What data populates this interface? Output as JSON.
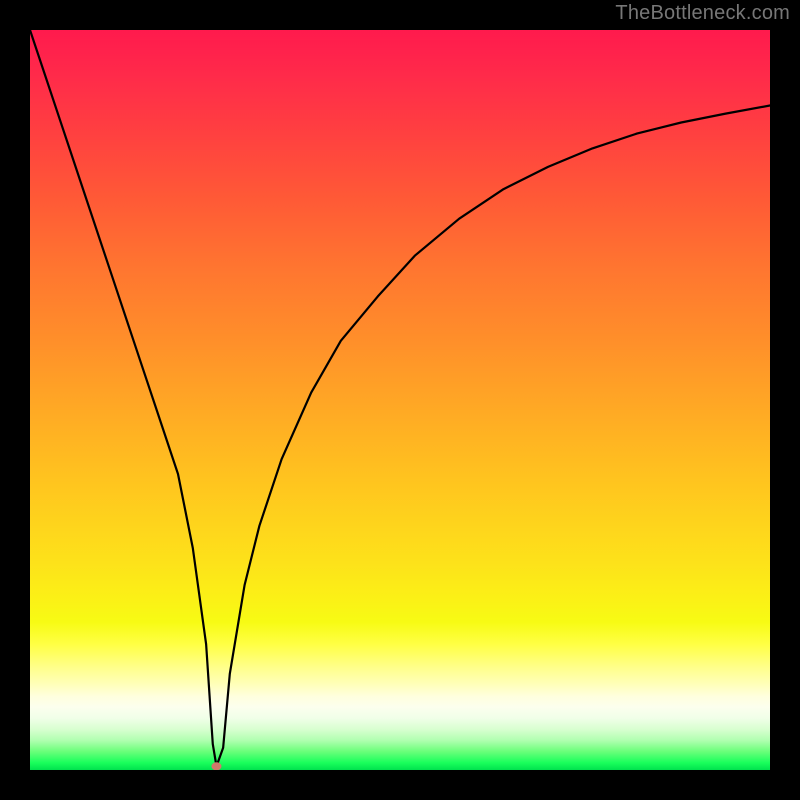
{
  "watermark": "TheBottleneck.com",
  "chart_data": {
    "type": "line",
    "title": "",
    "xlabel": "",
    "ylabel": "",
    "xlim": [
      0,
      100
    ],
    "ylim": [
      0,
      100
    ],
    "grid": false,
    "legend": false,
    "series": [
      {
        "name": "bottleneck-curve",
        "x": [
          0,
          2,
          5,
          8,
          11,
          14,
          17,
          20,
          22,
          23.8,
          24.7,
          25.2,
          26.1,
          27,
          29,
          31,
          34,
          38,
          42,
          47,
          52,
          58,
          64,
          70,
          76,
          82,
          88,
          94,
          100
        ],
        "y": [
          100,
          94,
          85,
          76,
          67,
          58,
          49,
          40,
          30,
          17,
          3.5,
          0.5,
          3,
          13,
          25,
          33,
          42,
          51,
          58,
          64,
          69.5,
          74.5,
          78.5,
          81.5,
          84,
          86,
          87.5,
          88.7,
          89.8
        ]
      }
    ],
    "marker": {
      "x": 25.2,
      "y": 0.5,
      "color": "#d1796a",
      "rx": 5,
      "ry": 4
    },
    "colors": {
      "frame": "#000000",
      "curve": "#000000",
      "gradient_top": "#ff1a4d",
      "gradient_bottom": "#00e24e"
    }
  }
}
